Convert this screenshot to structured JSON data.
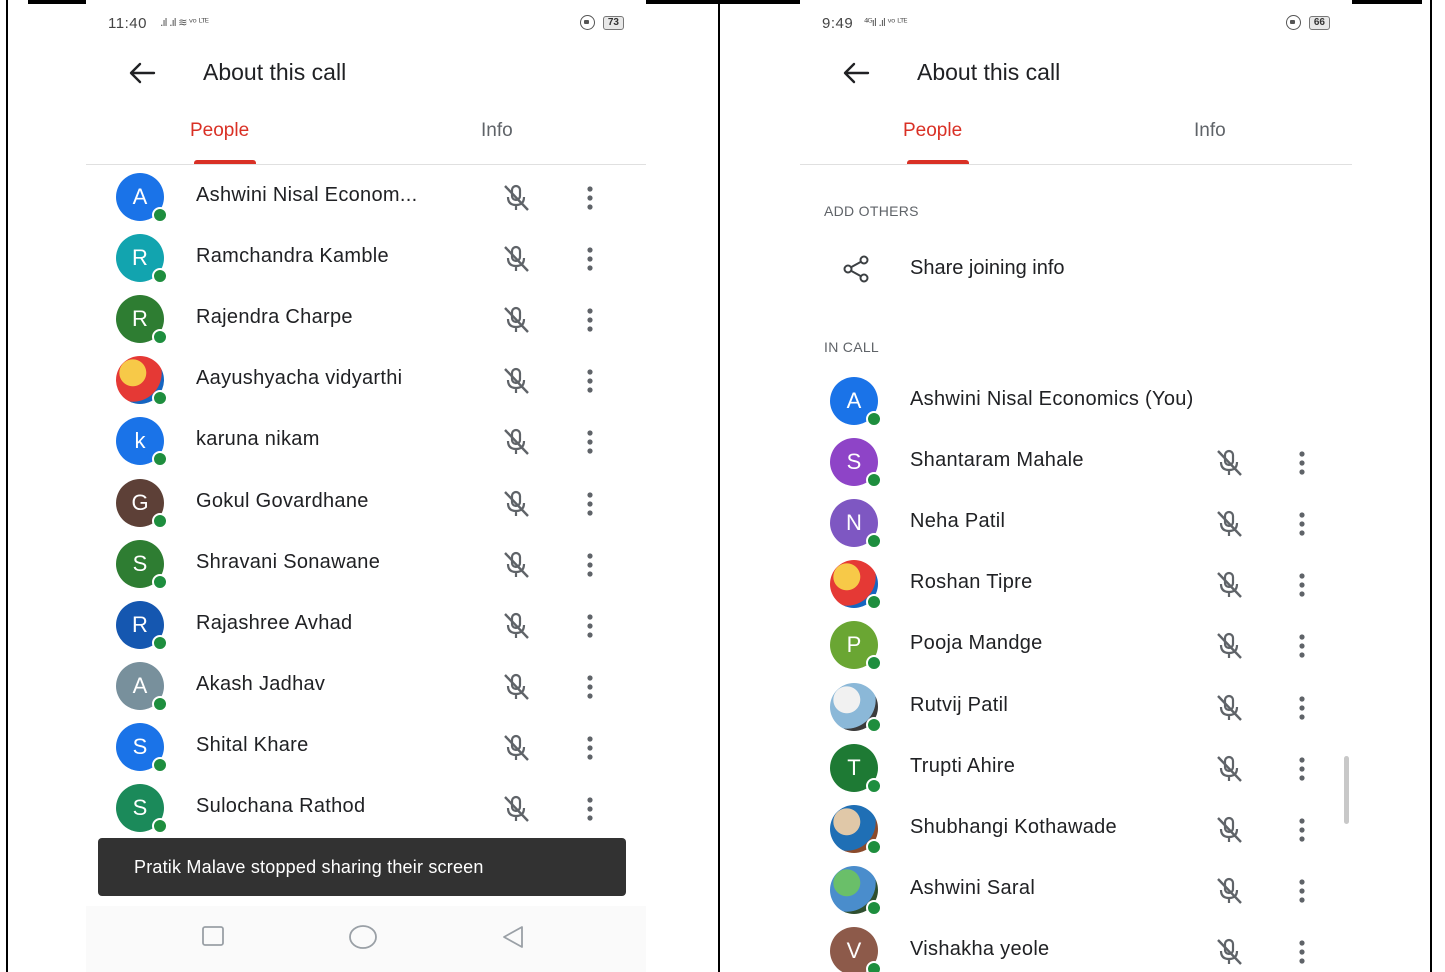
{
  "left_panel": {
    "status": {
      "time": "11:40",
      "signal": ".ıl .ıl ≋ ᵛᵒ ᴸᵀᴱ",
      "battery": "73"
    },
    "title": "About this call",
    "tabs": {
      "people": "People",
      "info": "Info"
    },
    "participants": [
      {
        "initial": "A",
        "color": "#1a73e8",
        "name": "Ashwini Nisal Econom..."
      },
      {
        "initial": "R",
        "color": "#12a4af",
        "name": "Ramchandra Kamble"
      },
      {
        "initial": "R",
        "color": "#2e7d32",
        "name": "Rajendra Charpe"
      },
      {
        "initial": "",
        "photo": true,
        "name": "Aayushyacha vidyarthi"
      },
      {
        "initial": "k",
        "color": "#1a73e8",
        "name": "karuna nikam"
      },
      {
        "initial": "G",
        "color": "#5d4037",
        "name": "Gokul Govardhane"
      },
      {
        "initial": "S",
        "color": "#2e7d32",
        "name": "Shravani Sonawane"
      },
      {
        "initial": "R",
        "color": "#1557b0",
        "name": "Rajashree Avhad"
      },
      {
        "initial": "A",
        "color": "#78909c",
        "name": "Akash Jadhav"
      },
      {
        "initial": "S",
        "color": "#1a73e8",
        "name": "Shital Khare"
      },
      {
        "initial": "S",
        "color": "#1b8a5a",
        "name": "Sulochana Rathod"
      }
    ],
    "toast": "Pratik Malave stopped sharing their screen"
  },
  "right_panel": {
    "status": {
      "time": "9:49",
      "signal": "⁴ᴳıl .ıl ᵛᵒ ᴸᵀᴱ",
      "battery": "66"
    },
    "title": "About this call",
    "tabs": {
      "people": "People",
      "info": "Info"
    },
    "add_others_label": "ADD OTHERS",
    "share_label": "Share joining info",
    "in_call_label": "IN CALL",
    "participants": [
      {
        "initial": "A",
        "color": "#1a73e8",
        "name": "Ashwini Nisal Economics (You)",
        "self": true
      },
      {
        "initial": "S",
        "color": "#8e44c7",
        "name": "Shantaram Mahale"
      },
      {
        "initial": "N",
        "color": "#7e57c2",
        "name": "Neha Patil"
      },
      {
        "initial": "",
        "photo": true,
        "name": "Roshan Tipre"
      },
      {
        "initial": "P",
        "color": "#6aa633",
        "name": "Pooja Mandge"
      },
      {
        "initial": "",
        "photo": true,
        "name": "Rutvij Patil"
      },
      {
        "initial": "T",
        "color": "#1e7a34",
        "name": "Trupti Ahire"
      },
      {
        "initial": "",
        "photo": true,
        "name": "Shubhangi Kothawade"
      },
      {
        "initial": "",
        "photo": true,
        "name": "Ashwini Saral"
      },
      {
        "initial": "V",
        "color": "#8d5a4a",
        "name": "Vishakha yeole"
      }
    ]
  }
}
